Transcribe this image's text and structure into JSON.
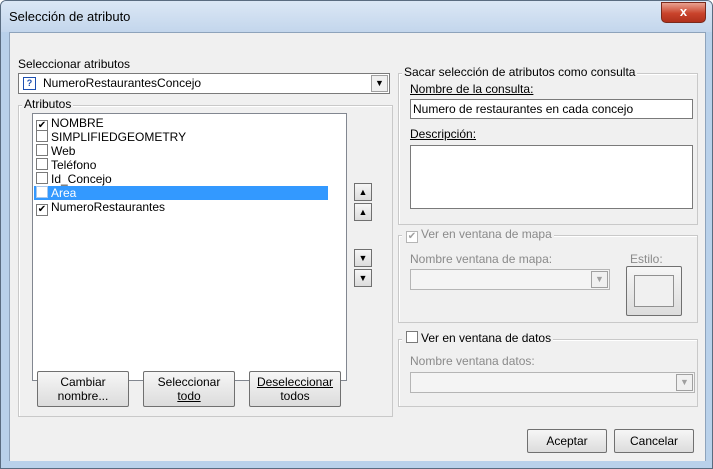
{
  "window": {
    "title": "Selección de atributo",
    "close_symbol": "x"
  },
  "left": {
    "select_label": "Seleccionar atributos",
    "select_value": "NumeroRestaurantesConcejo",
    "select_icon_glyph": "?",
    "attributes_group": "Atributos",
    "attributes": [
      {
        "label": "NOMBRE",
        "checked": true
      },
      {
        "label": "SIMPLIFIEDGEOMETRY",
        "checked": false
      },
      {
        "label": "Web",
        "checked": false
      },
      {
        "label": "Teléfono",
        "checked": false
      },
      {
        "label": "Id_Concejo",
        "checked": false
      },
      {
        "label": "Area",
        "checked": false,
        "selected": true
      },
      {
        "label": "NumeroRestaurantes",
        "checked": true
      }
    ],
    "buttons": {
      "rename": [
        "Cambiar",
        "nombre..."
      ],
      "select_all": [
        "Seleccionar",
        "todo"
      ],
      "deselect_all": [
        "Deseleccionar",
        "todos"
      ]
    },
    "move_buttons": {
      "top": "⏫",
      "up": "▲",
      "down": "▼",
      "bottom": "⏬"
    }
  },
  "right": {
    "query_group": "Sacar selección de atributos como consulta",
    "query_name_label": "Nombre de la consulta:",
    "query_name_value": "Numero de restaurantes en cada concejo",
    "description_label": "Descripción:",
    "description_value": "",
    "map_group": "Ver en ventana de mapa",
    "map_checked": true,
    "map_name_label": "Nombre ventana de mapa:",
    "style_label": "Estilo:",
    "data_group": "Ver en ventana de datos",
    "data_checked": false,
    "data_name_label": "Nombre ventana datos:"
  },
  "footer": {
    "accept": "Aceptar",
    "cancel": "Cancelar"
  }
}
